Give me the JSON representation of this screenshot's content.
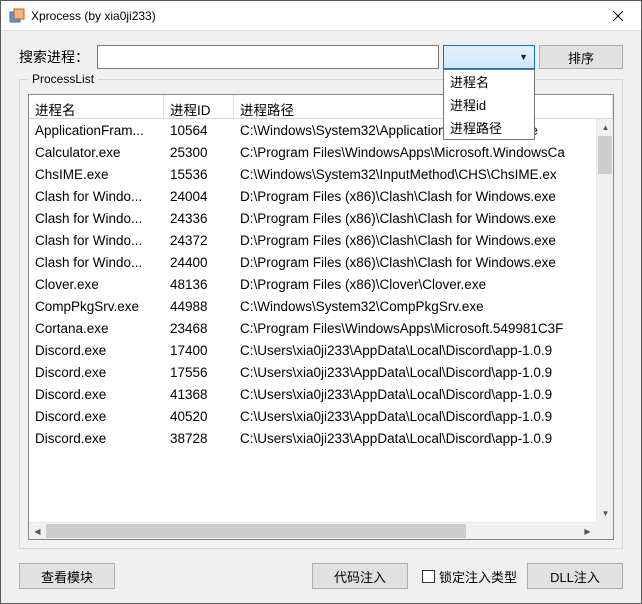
{
  "window": {
    "title": "Xprocess (by xia0ji233)"
  },
  "search": {
    "label": "搜索进程：",
    "value": "",
    "placeholder": ""
  },
  "combo": {
    "options": [
      "进程名",
      "进程id",
      "进程路径"
    ]
  },
  "buttons": {
    "sort": "排序",
    "view_module": "查看模块",
    "code_inject": "代码注入",
    "dll_inject": "DLL注入"
  },
  "checkbox": {
    "lock_inject_type": "锁定注入类型",
    "checked": false
  },
  "group": {
    "label": "ProcessList"
  },
  "columns": {
    "name": "进程名",
    "id": "进程ID",
    "path": "进程路径"
  },
  "rows": [
    {
      "name": "ApplicationFram...",
      "id": "10564",
      "path": "C:\\Windows\\System32\\ApplicationFrameHost.exe"
    },
    {
      "name": "Calculator.exe",
      "id": "25300",
      "path": "C:\\Program Files\\WindowsApps\\Microsoft.WindowsCa"
    },
    {
      "name": "ChsIME.exe",
      "id": "15536",
      "path": "C:\\Windows\\System32\\InputMethod\\CHS\\ChsIME.ex"
    },
    {
      "name": "Clash for Windo...",
      "id": "24004",
      "path": "D:\\Program Files (x86)\\Clash\\Clash for Windows.exe"
    },
    {
      "name": "Clash for Windo...",
      "id": "24336",
      "path": "D:\\Program Files (x86)\\Clash\\Clash for Windows.exe"
    },
    {
      "name": "Clash for Windo...",
      "id": "24372",
      "path": "D:\\Program Files (x86)\\Clash\\Clash for Windows.exe"
    },
    {
      "name": "Clash for Windo...",
      "id": "24400",
      "path": "D:\\Program Files (x86)\\Clash\\Clash for Windows.exe"
    },
    {
      "name": "Clover.exe",
      "id": "48136",
      "path": "D:\\Program Files (x86)\\Clover\\Clover.exe"
    },
    {
      "name": "CompPkgSrv.exe",
      "id": "44988",
      "path": "C:\\Windows\\System32\\CompPkgSrv.exe"
    },
    {
      "name": "Cortana.exe",
      "id": "23468",
      "path": "C:\\Program Files\\WindowsApps\\Microsoft.549981C3F"
    },
    {
      "name": "Discord.exe",
      "id": "17400",
      "path": "C:\\Users\\xia0ji233\\AppData\\Local\\Discord\\app-1.0.9"
    },
    {
      "name": "Discord.exe",
      "id": "17556",
      "path": "C:\\Users\\xia0ji233\\AppData\\Local\\Discord\\app-1.0.9"
    },
    {
      "name": "Discord.exe",
      "id": "41368",
      "path": "C:\\Users\\xia0ji233\\AppData\\Local\\Discord\\app-1.0.9"
    },
    {
      "name": "Discord.exe",
      "id": "40520",
      "path": "C:\\Users\\xia0ji233\\AppData\\Local\\Discord\\app-1.0.9"
    },
    {
      "name": "Discord.exe",
      "id": "38728",
      "path": "C:\\Users\\xia0ji233\\AppData\\Local\\Discord\\app-1.0.9"
    }
  ]
}
